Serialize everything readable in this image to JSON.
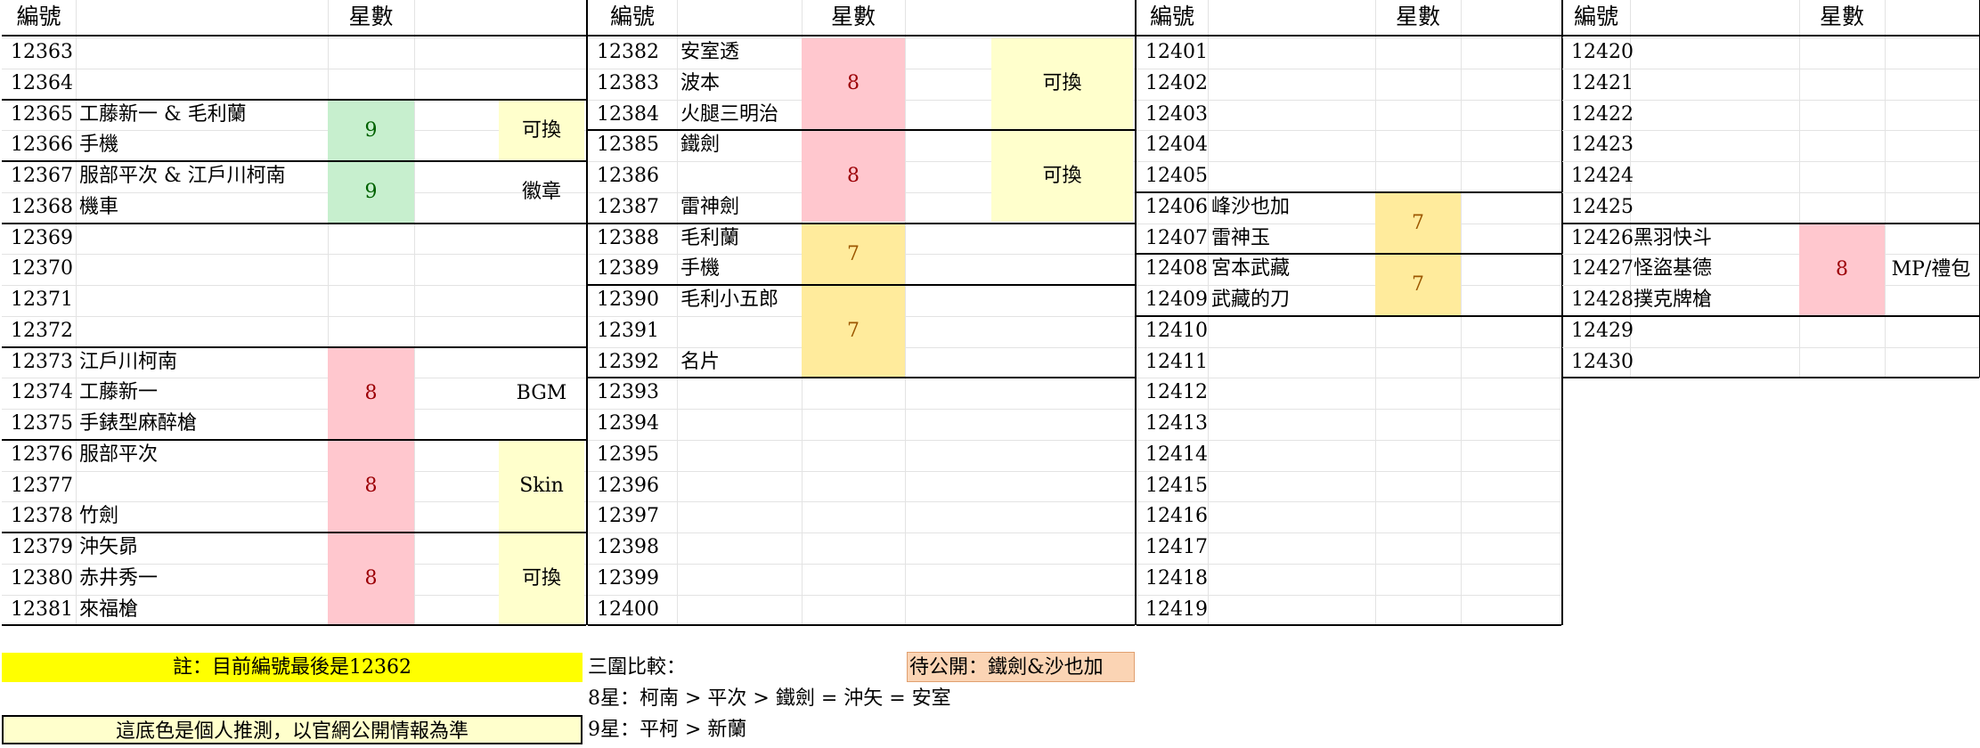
{
  "colors": {
    "green_fill": "#c7efce",
    "green_text": "#006100",
    "pink_fill": "#ffc7ce",
    "pink_text": "#9c0006",
    "gold_fill": "#ffeb9c",
    "gold_text": "#9c5700",
    "light_yellow": "#ffffcc",
    "yellow": "#ffff00",
    "orange": "#fbd4b4"
  },
  "headers": {
    "id": "編號",
    "stars": "星數"
  },
  "columns": [
    {
      "rows": [
        {
          "id": "12363",
          "name": ""
        },
        {
          "id": "12364",
          "name": ""
        },
        {
          "id": "12365",
          "name": "工藤新一 & 毛利蘭"
        },
        {
          "id": "12366",
          "name": "手機"
        },
        {
          "id": "12367",
          "name": "服部平次 & 江戶川柯南"
        },
        {
          "id": "12368",
          "name": "機車"
        },
        {
          "id": "12369",
          "name": ""
        },
        {
          "id": "12370",
          "name": ""
        },
        {
          "id": "12371",
          "name": ""
        },
        {
          "id": "12372",
          "name": ""
        },
        {
          "id": "12373",
          "name": "江戶川柯南"
        },
        {
          "id": "12374",
          "name": "工藤新一"
        },
        {
          "id": "12375",
          "name": "手錶型麻醉槍"
        },
        {
          "id": "12376",
          "name": "服部平次"
        },
        {
          "id": "12377",
          "name": ""
        },
        {
          "id": "12378",
          "name": "竹劍"
        },
        {
          "id": "12379",
          "name": "沖矢昴"
        },
        {
          "id": "12380",
          "name": "赤井秀一"
        },
        {
          "id": "12381",
          "name": "來福槍"
        }
      ],
      "stars": [
        {
          "start": 2,
          "span": 2,
          "value": "9",
          "color": "green"
        },
        {
          "start": 4,
          "span": 2,
          "value": "9",
          "color": "green"
        },
        {
          "start": 10,
          "span": 3,
          "value": "8",
          "color": "pink"
        },
        {
          "start": 13,
          "span": 3,
          "value": "8",
          "color": "pink"
        },
        {
          "start": 16,
          "span": 3,
          "value": "8",
          "color": "pink"
        }
      ],
      "notes": [
        {
          "start": 2,
          "span": 2,
          "value": "可換",
          "fill": true
        },
        {
          "start": 4,
          "span": 2,
          "value": "徽章",
          "fill": false
        },
        {
          "start": 10,
          "span": 3,
          "value": "BGM",
          "fill": false
        },
        {
          "start": 13,
          "span": 3,
          "value": "Skin",
          "fill": true
        },
        {
          "start": 16,
          "span": 3,
          "value": "可換",
          "fill": true
        }
      ],
      "dividers": [
        2,
        4,
        6,
        10,
        13,
        16
      ]
    },
    {
      "rows": [
        {
          "id": "12382",
          "name": "安室透"
        },
        {
          "id": "12383",
          "name": "波本"
        },
        {
          "id": "12384",
          "name": "火腿三明治"
        },
        {
          "id": "12385",
          "name": "鐵劍"
        },
        {
          "id": "12386",
          "name": ""
        },
        {
          "id": "12387",
          "name": "雷神劍"
        },
        {
          "id": "12388",
          "name": "毛利蘭"
        },
        {
          "id": "12389",
          "name": "手機"
        },
        {
          "id": "12390",
          "name": "毛利小五郎"
        },
        {
          "id": "12391",
          "name": ""
        },
        {
          "id": "12392",
          "name": "名片"
        },
        {
          "id": "12393",
          "name": ""
        },
        {
          "id": "12394",
          "name": ""
        },
        {
          "id": "12395",
          "name": ""
        },
        {
          "id": "12396",
          "name": ""
        },
        {
          "id": "12397",
          "name": ""
        },
        {
          "id": "12398",
          "name": ""
        },
        {
          "id": "12399",
          "name": ""
        },
        {
          "id": "12400",
          "name": ""
        }
      ],
      "stars": [
        {
          "start": 0,
          "span": 3,
          "value": "8",
          "color": "pink"
        },
        {
          "start": 3,
          "span": 3,
          "value": "8",
          "color": "pink"
        },
        {
          "start": 6,
          "span": 2,
          "value": "7",
          "color": "gold"
        },
        {
          "start": 8,
          "span": 3,
          "value": "7",
          "color": "gold"
        }
      ],
      "notes": [
        {
          "start": 0,
          "span": 3,
          "value": "可換",
          "fill": true
        },
        {
          "start": 3,
          "span": 3,
          "value": "可換",
          "fill": true
        }
      ],
      "dividers": [
        3,
        6,
        8,
        11
      ]
    },
    {
      "rows": [
        {
          "id": "12401",
          "name": ""
        },
        {
          "id": "12402",
          "name": ""
        },
        {
          "id": "12403",
          "name": ""
        },
        {
          "id": "12404",
          "name": ""
        },
        {
          "id": "12405",
          "name": ""
        },
        {
          "id": "12406",
          "name": "峰沙也加"
        },
        {
          "id": "12407",
          "name": "雷神玉"
        },
        {
          "id": "12408",
          "name": "宮本武藏"
        },
        {
          "id": "12409",
          "name": "武藏的刀"
        },
        {
          "id": "12410",
          "name": ""
        },
        {
          "id": "12411",
          "name": ""
        },
        {
          "id": "12412",
          "name": ""
        },
        {
          "id": "12413",
          "name": ""
        },
        {
          "id": "12414",
          "name": ""
        },
        {
          "id": "12415",
          "name": ""
        },
        {
          "id": "12416",
          "name": ""
        },
        {
          "id": "12417",
          "name": ""
        },
        {
          "id": "12418",
          "name": ""
        },
        {
          "id": "12419",
          "name": ""
        }
      ],
      "stars": [
        {
          "start": 5,
          "span": 2,
          "value": "7",
          "color": "gold"
        },
        {
          "start": 7,
          "span": 2,
          "value": "7",
          "color": "gold"
        }
      ],
      "notes": [],
      "dividers": [
        5,
        7,
        9
      ]
    },
    {
      "rows": [
        {
          "id": "12420",
          "name": ""
        },
        {
          "id": "12421",
          "name": ""
        },
        {
          "id": "12422",
          "name": ""
        },
        {
          "id": "12423",
          "name": ""
        },
        {
          "id": "12424",
          "name": ""
        },
        {
          "id": "12425",
          "name": ""
        },
        {
          "id": "12426",
          "name": "黑羽快斗"
        },
        {
          "id": "12427",
          "name": "怪盜基德"
        },
        {
          "id": "12428",
          "name": "撲克牌槍"
        },
        {
          "id": "12429",
          "name": ""
        },
        {
          "id": "12430",
          "name": ""
        }
      ],
      "stars": [
        {
          "start": 6,
          "span": 3,
          "value": "8",
          "color": "pink"
        }
      ],
      "notes": [
        {
          "start": 6,
          "span": 3,
          "value": "MP/禮包",
          "fill": false
        }
      ],
      "dividers": [
        6,
        9
      ]
    }
  ],
  "footer": {
    "note_current": "註：目前編號最後是12362",
    "note_color": "這底色是個人推測，以官網公開情報為準",
    "compare_title": "三圍比較：",
    "pending": "待公開：鐵劍&沙也加",
    "compare_8": "8星：柯南 > 平次 > 鐵劍 = 沖矢 = 安室",
    "compare_9": "9星：平柯 > 新蘭"
  }
}
